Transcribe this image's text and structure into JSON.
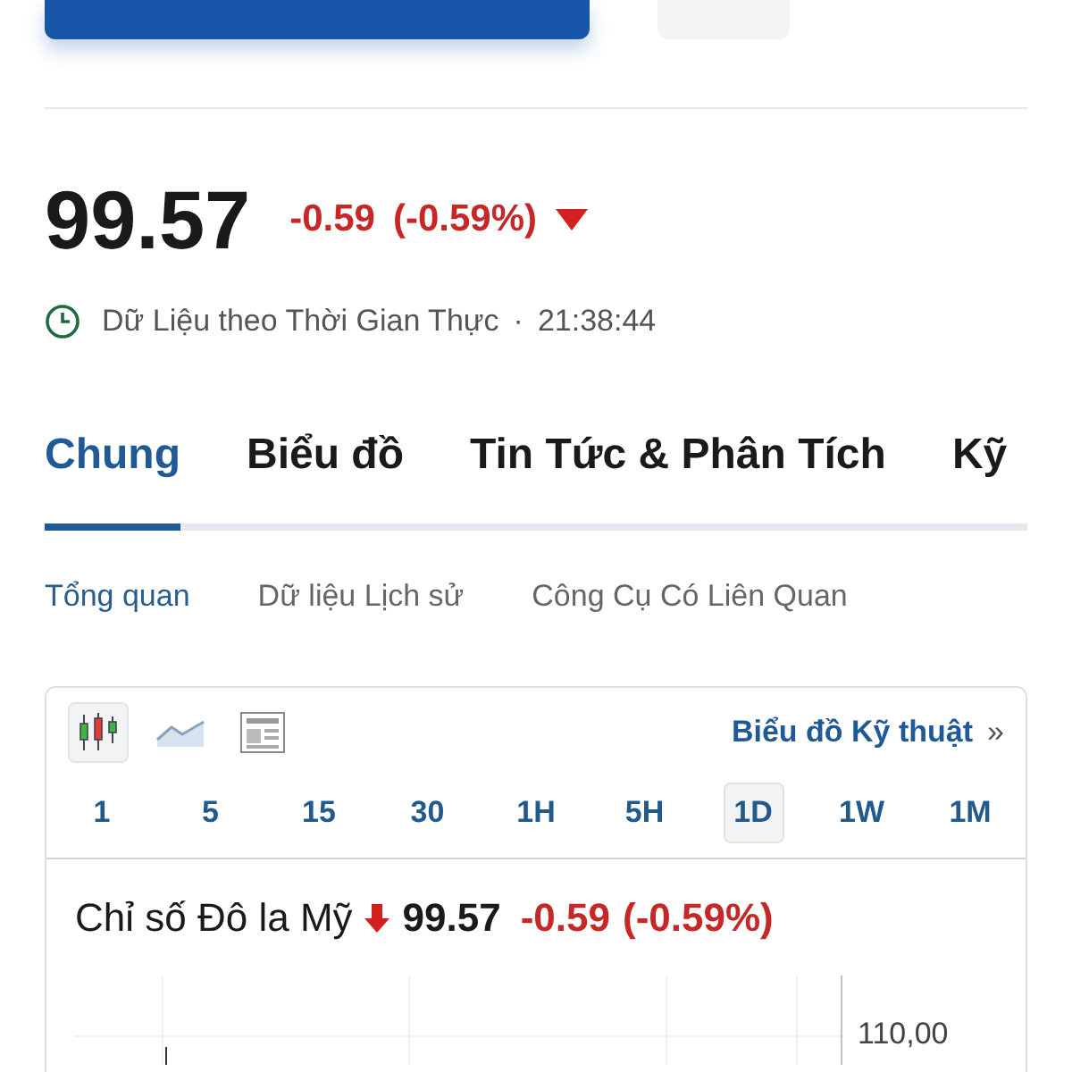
{
  "quote": {
    "price": "99.57",
    "change": "-0.59",
    "change_percent": "(-0.59%)",
    "falling": true
  },
  "status": {
    "label": "Dữ Liệu theo Thời Gian Thực",
    "separator": "·",
    "time": "21:38:44"
  },
  "tabs": [
    {
      "label": "Chung",
      "selected": true
    },
    {
      "label": "Biểu đồ",
      "selected": false
    },
    {
      "label": "Tin Tức & Phân Tích",
      "selected": false
    },
    {
      "label": "Kỹ",
      "selected": false
    }
  ],
  "subtabs": [
    {
      "label": "Tổng quan",
      "selected": true
    },
    {
      "label": "Dữ liệu Lịch sử",
      "selected": false
    },
    {
      "label": "Công Cụ Có Liên Quan",
      "selected": false
    }
  ],
  "chart_widget": {
    "chart_types": [
      {
        "kind": "candle",
        "selected": true
      },
      {
        "kind": "area",
        "selected": false
      },
      {
        "kind": "table",
        "selected": false
      }
    ],
    "technical_link": "Biểu đồ Kỹ thuật",
    "technical_link_arrow": "»",
    "timeframes": [
      {
        "label": "1",
        "selected": false
      },
      {
        "label": "5",
        "selected": false
      },
      {
        "label": "15",
        "selected": false
      },
      {
        "label": "30",
        "selected": false
      },
      {
        "label": "1H",
        "selected": false
      },
      {
        "label": "5H",
        "selected": false
      },
      {
        "label": "1D",
        "selected": true
      },
      {
        "label": "1W",
        "selected": false
      },
      {
        "label": "1M",
        "selected": false
      }
    ],
    "title": "Chỉ số Đô la Mỹ",
    "falling": true,
    "price": "99.57",
    "change": "-0.59",
    "change_percent": "(-0.59%)",
    "y_axis_label": "110,00"
  }
}
